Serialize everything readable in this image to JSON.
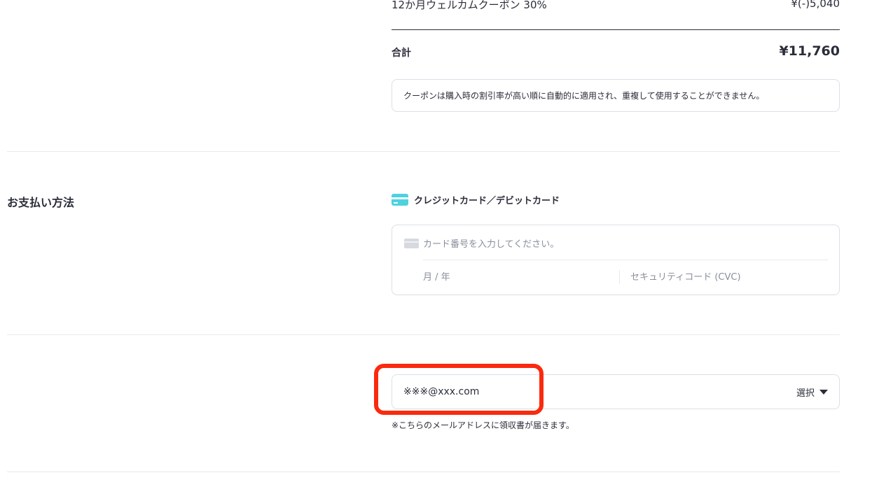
{
  "order_summary": {
    "coupon_label": "12か月ウェルカムクーポン 30%",
    "coupon_value": "¥(-)5,040",
    "total_label": "合計",
    "total_value": "¥11,760",
    "notice": "クーポンは購入時の割引率が高い順に自動的に適用され、重複して使用することができません。"
  },
  "payment": {
    "section_title": "お支払い方法",
    "method_label": "クレジットカード／デビットカード",
    "card_number_placeholder": "カード番号を入力してください。",
    "expiry_placeholder": "月 / 年",
    "cvc_placeholder": "セキュリティコード (CVC)"
  },
  "email": {
    "value": "※※※@xxx.com",
    "select_label": "選択",
    "note": "※こちらのメールアドレスに領収書が届きます。"
  },
  "colors": {
    "text": "#2b2d3a",
    "border": "#dcdfe6",
    "accent_card": "#4fd1de",
    "highlight": "#fa2a0e"
  }
}
